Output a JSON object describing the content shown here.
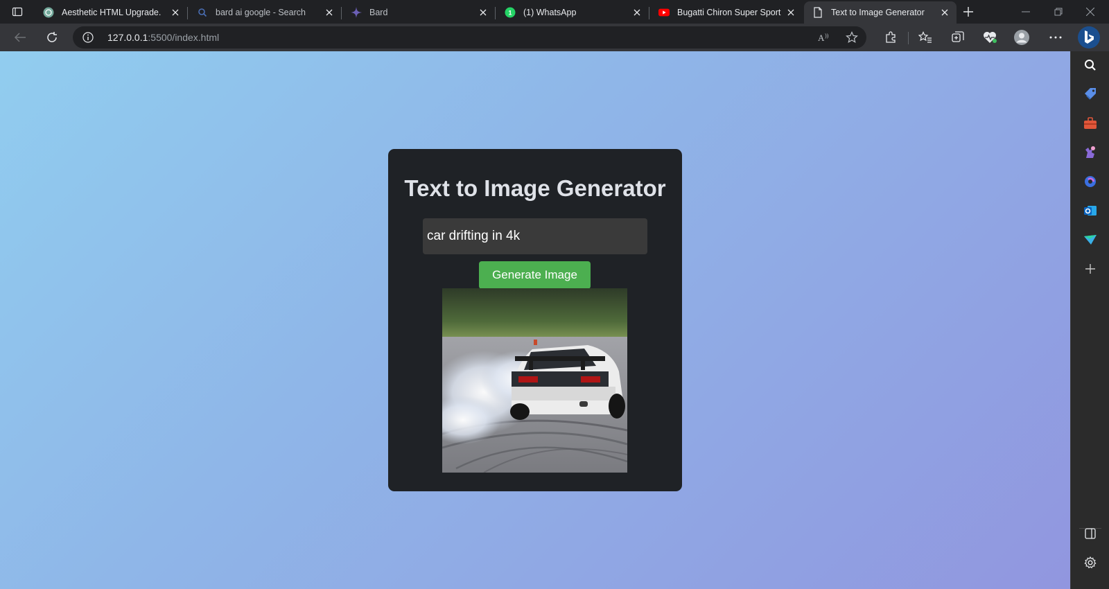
{
  "browser": {
    "tabs": [
      {
        "label": "Aesthetic HTML Upgrade.",
        "icon": "chatgpt-icon",
        "active": false
      },
      {
        "label": "bard ai google - Search",
        "icon": "search-icon",
        "active": false
      },
      {
        "label": "Bard",
        "icon": "bard-sparkle-icon",
        "active": false
      },
      {
        "label": "(1) WhatsApp",
        "icon": "whatsapp-icon",
        "active": false
      },
      {
        "label": "Bugatti Chiron Super Sport",
        "icon": "youtube-icon",
        "active": false
      },
      {
        "label": "Text to Image Generator",
        "icon": "page-icon",
        "active": true
      }
    ],
    "url_host": "127.0.0.1",
    "url_rest": ":5500/index.html",
    "colors": {
      "tab_bg": "#202124",
      "toolbar_bg": "#35363a",
      "text": "#e8eaed"
    }
  },
  "page": {
    "title": "Text to Image Generator",
    "prompt_value": "car drifting in 4k",
    "generate_label": "Generate Image",
    "result_image": "white sports car drifting with tire smoke",
    "colors": {
      "background_start": "#91cdef",
      "background_end": "#9196df",
      "card": "#1f2226",
      "button": "#4caf50",
      "input": "#3a3a3a"
    }
  },
  "sidebar": {
    "icons": [
      "search-icon",
      "shopping-tag-icon",
      "tools-icon",
      "games-icon",
      "copilot-icon",
      "outlook-icon",
      "drop-icon",
      "add-icon",
      "split-screen-icon",
      "settings-icon"
    ]
  }
}
